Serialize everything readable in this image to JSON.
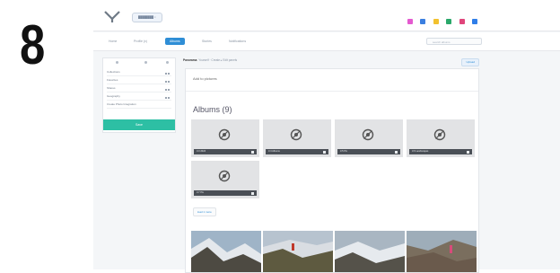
{
  "step_number": "8",
  "header": {
    "breadcrumb_pill": "████████ ×",
    "icon_colors": [
      "#e45ad0",
      "#3b7fe0",
      "#f2c12e",
      "#2aa86a",
      "#e0457b",
      "#2f7ee8"
    ]
  },
  "nav": {
    "tabs": [
      {
        "label": "Home",
        "active": false
      },
      {
        "label": "Profile (x)",
        "active": false
      },
      {
        "label": "Albums",
        "active": true
      },
      {
        "label": "Stories",
        "active": false
      },
      {
        "label": "Notifications",
        "active": false
      }
    ],
    "search_placeholder": "search albums"
  },
  "sidebar": {
    "items": [
      {
        "label": "Collections"
      },
      {
        "label": "Favorites"
      },
      {
        "label": "Shares"
      },
      {
        "label": "Geography"
      },
      {
        "label": "Create Photo Integration"
      }
    ],
    "cta_label": "Save"
  },
  "main": {
    "breadcrumb_current": "Panorama",
    "breadcrumb_path": "Yourself · Create ▸ Edit panels",
    "breadcrumb_button": "Upload",
    "panel_title": "Add to pictures",
    "albums_heading": "Albums (9)",
    "albums": [
      {
        "caption": "3.3 2024"
      },
      {
        "caption": "3.4 Albums"
      },
      {
        "caption": "3.5 Pix"
      },
      {
        "caption": "3.6 Landscapes"
      },
      {
        "caption": "3.7 Pix"
      }
    ],
    "load_more_label": "load 1 more",
    "photo_colors": [
      {
        "sky": "#9fb4c7",
        "ground": "#4d4a42"
      },
      {
        "sky": "#b7c3cf",
        "ground": "#5e5a40"
      },
      {
        "sky": "#a9b6c2",
        "ground": "#55524a"
      },
      {
        "sky": "#9eadb9",
        "ground": "#6a5a4c"
      }
    ]
  },
  "colors": {
    "accent": "#2f8ed6",
    "cta": "#2dbfa4"
  }
}
